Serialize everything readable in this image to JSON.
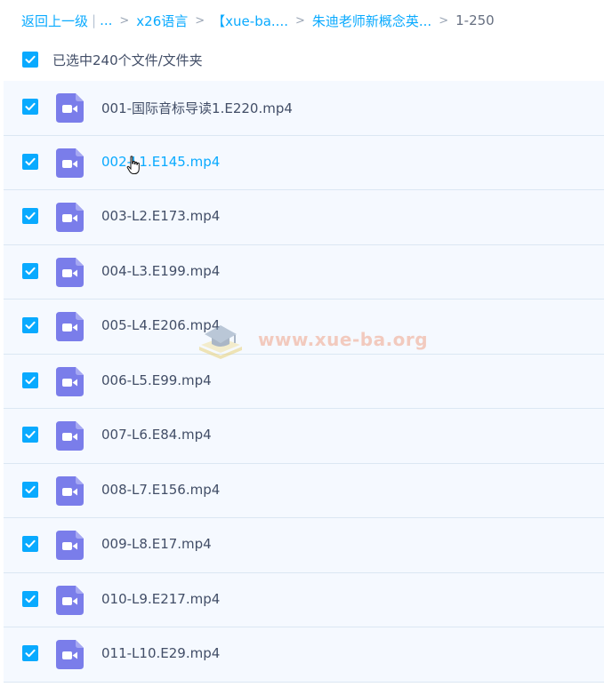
{
  "breadcrumb": {
    "back": "返回上一级",
    "bar": "|",
    "ellipsis": "...",
    "arrow": ">",
    "items": [
      "x26语言",
      "【xue-ba....",
      "朱迪老师新概念英..."
    ],
    "current": "1-250"
  },
  "selection": {
    "label": "已选中240个文件/文件夹",
    "checked": true
  },
  "files": [
    {
      "name": "001-国际音标导读1.E220.mp4",
      "checked": true
    },
    {
      "name": "002-L1.E145.mp4",
      "checked": true
    },
    {
      "name": "003-L2.E173.mp4",
      "checked": true
    },
    {
      "name": "004-L3.E199.mp4",
      "checked": true
    },
    {
      "name": "005-L4.E206.mp4",
      "checked": true
    },
    {
      "name": "006-L5.E99.mp4",
      "checked": true
    },
    {
      "name": "007-L6.E84.mp4",
      "checked": true
    },
    {
      "name": "008-L7.E156.mp4",
      "checked": true
    },
    {
      "name": "009-L8.E17.mp4",
      "checked": true
    },
    {
      "name": "010-L9.E217.mp4",
      "checked": true
    },
    {
      "name": "011-L10.E29.mp4",
      "checked": true
    }
  ],
  "watermark": {
    "text": "www.xue-ba.org"
  },
  "colors": {
    "accent": "#09aaff",
    "video_icon": "#7a7dea",
    "row_bg": "#f5f9ff"
  },
  "icons": {
    "file_type": "video-file-icon",
    "cursor": "hand-cursor-icon",
    "check": "check-icon"
  }
}
